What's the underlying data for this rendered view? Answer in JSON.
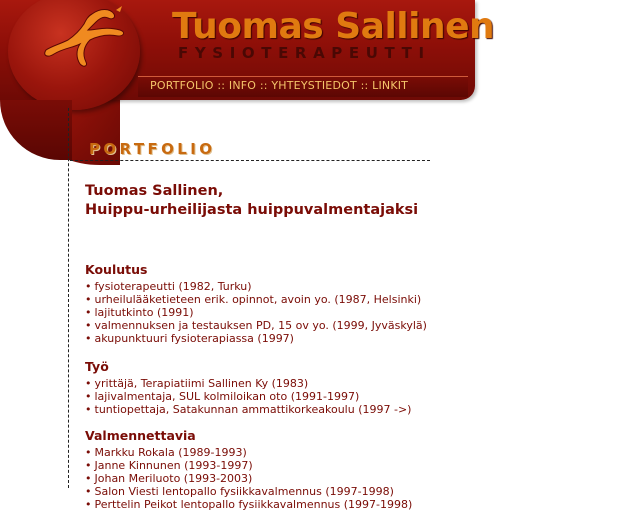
{
  "header": {
    "title": "Tuomas Sallinen",
    "subtitle": "FYSIOTERAPEUTTI",
    "logo_icon": "runner-logo-icon"
  },
  "nav": {
    "items": [
      "PORTFOLIO",
      "INFO",
      "YHTEYSTIEDOT",
      "LINKIT"
    ],
    "separator": "::"
  },
  "page": {
    "heading": "PORTFOLIO",
    "headline_line1": "Tuomas Sallinen,",
    "headline_line2": "Huippu-urheilijasta huippuvalmentajaksi"
  },
  "sections": [
    {
      "title": "Koulutus",
      "items": [
        "fysioterapeutti (1982, Turku)",
        "urheilulääketieteen erik. opinnot, avoin yo. (1987, Helsinki)",
        "lajitutkinto (1991)",
        "valmennuksen ja testauksen PD, 15 ov yo. (1999, Jyväskylä)",
        "akupunktuuri fysioterapiassa (1997)"
      ]
    },
    {
      "title": "Työ",
      "items": [
        "yrittäjä, Terapiatiimi Sallinen Ky (1983)",
        "lajivalmentaja, SUL kolmiloikan oto (1991-1997)",
        "tuntiopettaja, Satakunnan ammattikorkeakoulu (1997 ->)"
      ]
    },
    {
      "title": "Valmennettavia",
      "items": [
        "Markku Rokala (1989-1993)",
        "Janne Kinnunen (1993-1997)",
        "Johan Meriluoto (1993-2003)",
        "Salon Viesti lentopallo fysiikkavalmennus (1997-1998)",
        "Perttelin Peikot lentopallo fysiikkavalmennus (1997-1998)"
      ]
    }
  ],
  "bullet": "•",
  "colors": {
    "brand_red": "#8e0f08",
    "title_orange": "#e07a10",
    "nav_text": "#f4c46a",
    "content_text": "#7a0c06"
  }
}
